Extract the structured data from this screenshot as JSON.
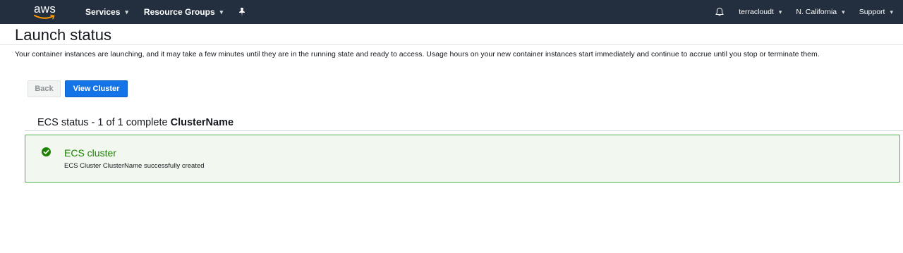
{
  "navbar": {
    "logo_text": "aws",
    "services_label": "Services",
    "resource_groups_label": "Resource Groups",
    "account_label": "terracloudt",
    "region_label": "N. California",
    "support_label": "Support"
  },
  "page": {
    "title": "Launch status",
    "description": "Your container instances are launching, and it may take a few minutes until they are in the running state and ready to access. Usage hours on your new container instances start immediately and continue to accrue until you stop or terminate them."
  },
  "buttons": {
    "back_label": "Back",
    "view_cluster_label": "View Cluster"
  },
  "status": {
    "heading_prefix": "ECS status - 1 of 1 complete",
    "cluster_name": "ClusterName",
    "item_title": "ECS cluster",
    "item_message": "ECS Cluster ClusterName successfully created"
  },
  "colors": {
    "navbar_bg": "#232f3e",
    "primary_button": "#1473e6",
    "success_green": "#1d8102",
    "success_border": "#4caf50"
  }
}
